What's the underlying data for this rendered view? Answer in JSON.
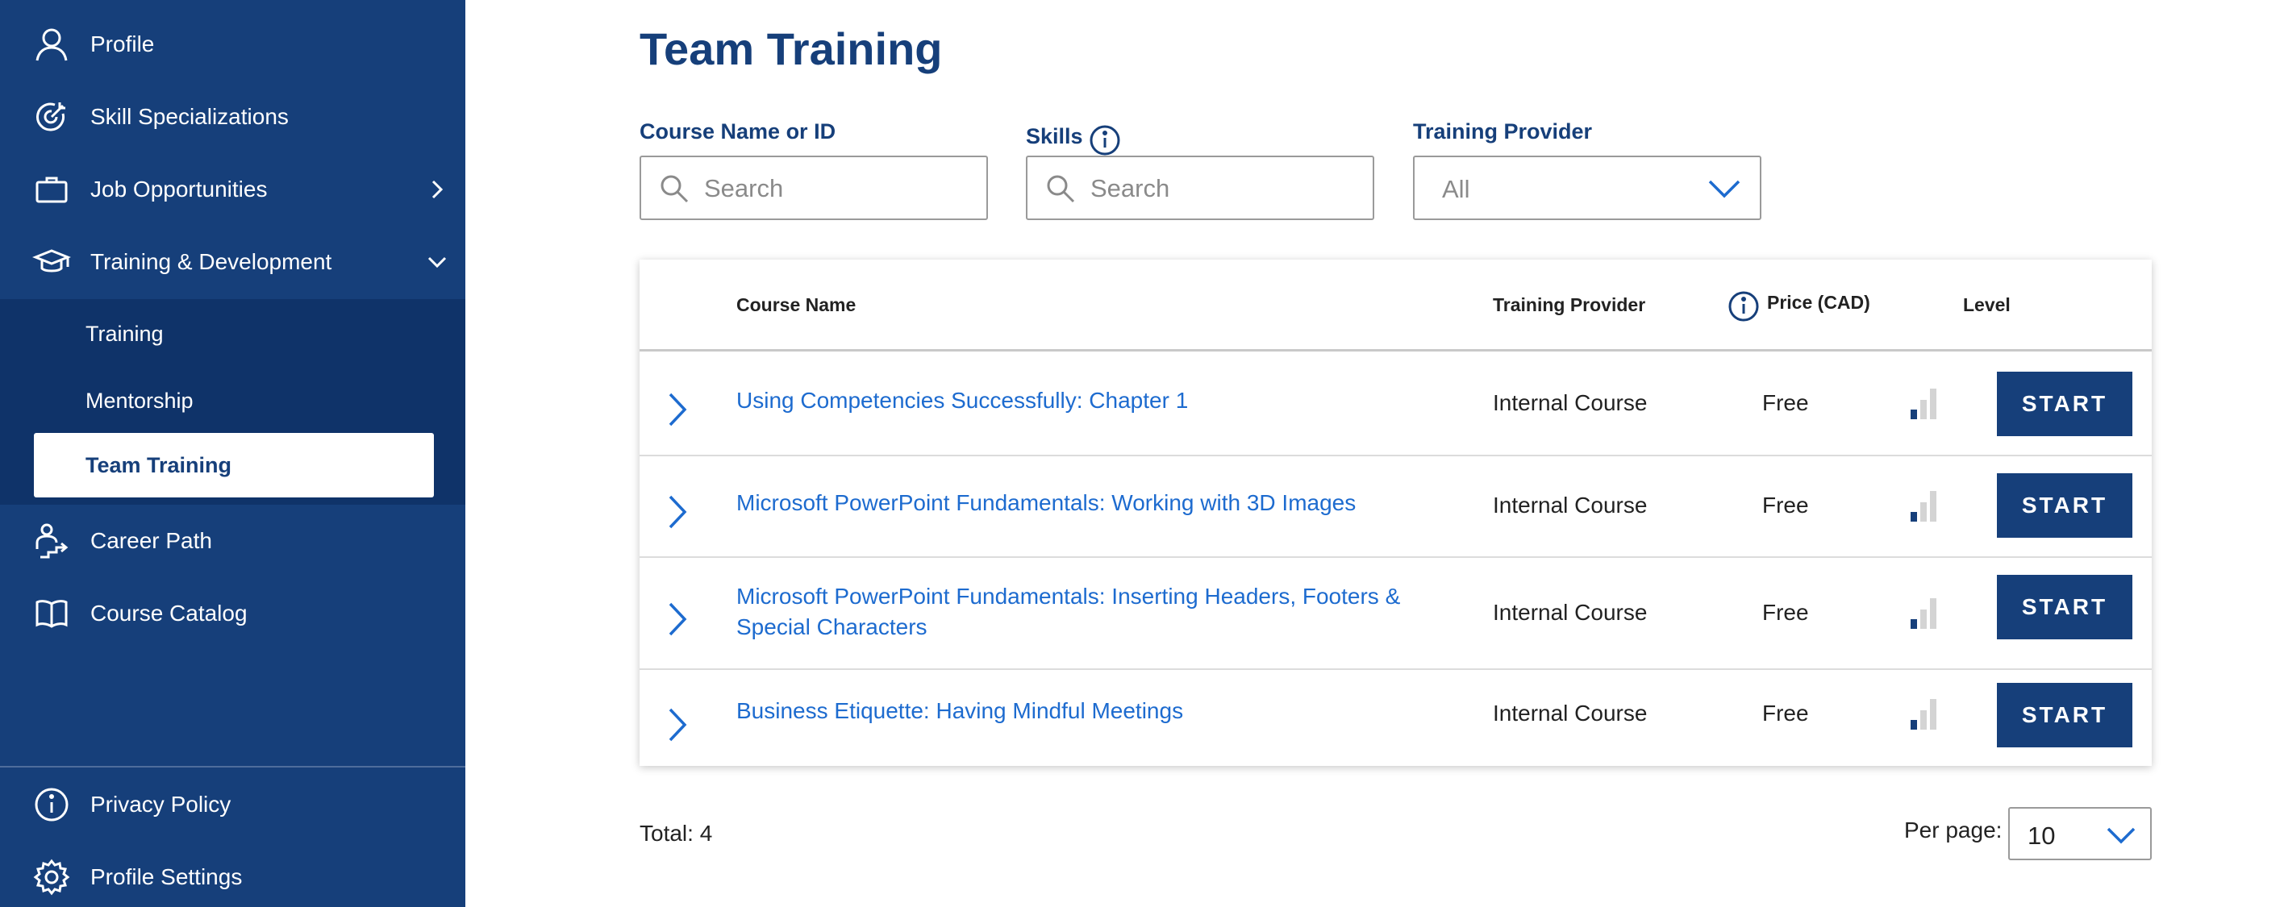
{
  "sidebar": {
    "items": [
      {
        "label": "Profile",
        "icon": "person-icon"
      },
      {
        "label": "Skill Specializations",
        "icon": "target-icon"
      },
      {
        "label": "Job Opportunities",
        "icon": "briefcase-icon"
      },
      {
        "label": "Training & Development",
        "icon": "graduation-cap-icon"
      },
      {
        "label": "Career Path",
        "icon": "career-path-icon"
      },
      {
        "label": "Course Catalog",
        "icon": "book-icon"
      }
    ],
    "subitems": [
      {
        "label": "Training"
      },
      {
        "label": "Mentorship"
      },
      {
        "label": "Team Training",
        "active": true
      }
    ],
    "footer": [
      {
        "label": "Privacy Policy",
        "icon": "info-icon"
      },
      {
        "label": "Profile Settings",
        "icon": "gear-icon"
      }
    ]
  },
  "page": {
    "title": "Team Training"
  },
  "filters": {
    "course": {
      "label": "Course Name or ID",
      "placeholder": "Search"
    },
    "skills": {
      "label": "Skills",
      "placeholder": "Search"
    },
    "provider": {
      "label": "Training Provider",
      "value": "All"
    }
  },
  "table": {
    "headers": {
      "course": "Course Name",
      "provider": "Training Provider",
      "price": "Price (CAD)",
      "level": "Level"
    },
    "rows": [
      {
        "name": "Using Competencies Successfully: Chapter 1",
        "provider": "Internal Course",
        "price": "Free",
        "level": 1,
        "action": "START"
      },
      {
        "name": "Microsoft PowerPoint Fundamentals: Working with 3D Images",
        "provider": "Internal Course",
        "price": "Free",
        "level": 1,
        "action": "START"
      },
      {
        "name": "Microsoft PowerPoint Fundamentals: Inserting Headers, Footers & Special Characters",
        "provider": "Internal Course",
        "price": "Free",
        "level": 1,
        "action": "START"
      },
      {
        "name": "Business Etiquette: Having Mindful Meetings",
        "provider": "Internal Course",
        "price": "Free",
        "level": 1,
        "action": "START"
      }
    ]
  },
  "footer": {
    "total": "Total: 4",
    "per_page_label": "Per page:",
    "per_page_value": "10"
  },
  "colors": {
    "sidebar": "#163f7a",
    "sidebar_sub": "#0f3369",
    "accent": "#163f7a",
    "link": "#1d6bcf"
  }
}
